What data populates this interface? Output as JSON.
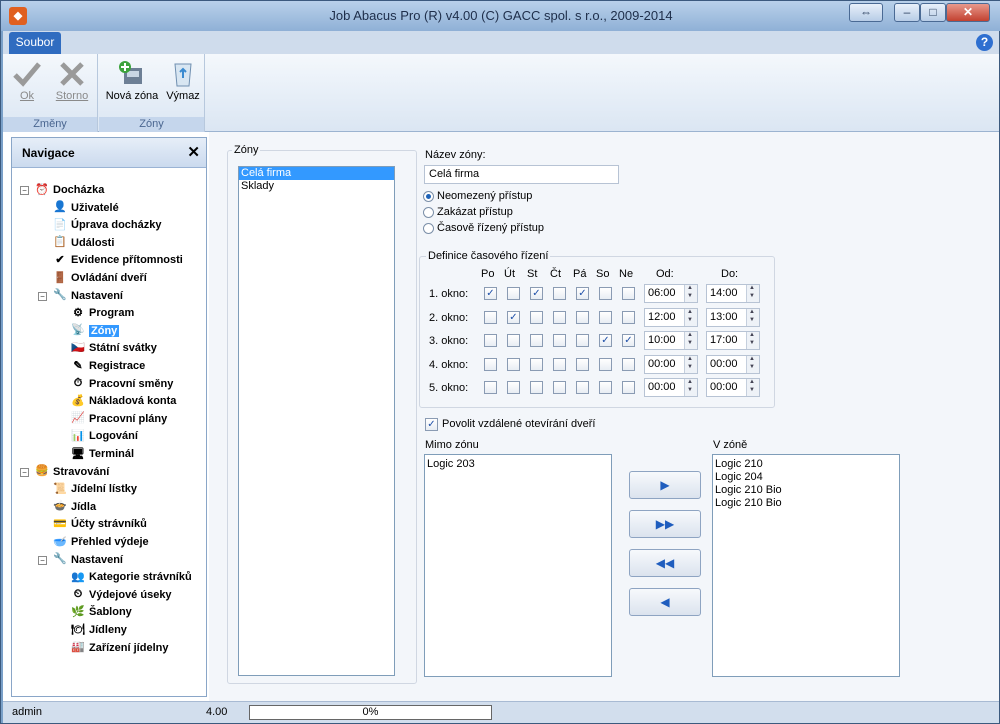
{
  "window": {
    "title": "Job Abacus Pro (R) v4.00 (C) GACC spol. s r.o., 2009-2014"
  },
  "ribbon": {
    "tab": "Soubor",
    "groups": [
      {
        "label": "Změny",
        "buttons": [
          "Ok",
          "Storno"
        ]
      },
      {
        "label": "Zóny",
        "buttons": [
          "Nová zóna",
          "Výmaz"
        ]
      }
    ]
  },
  "navigation": {
    "title": "Navigace",
    "items": [
      {
        "label": "Docházka"
      },
      {
        "label": "Uživatelé"
      },
      {
        "label": "Úprava docházky"
      },
      {
        "label": "Události"
      },
      {
        "label": "Evidence přítomnosti"
      },
      {
        "label": "Ovládání dveří"
      },
      {
        "label": "Nastavení"
      },
      {
        "label": "Program"
      },
      {
        "label": "Zóny"
      },
      {
        "label": "Státní svátky"
      },
      {
        "label": "Registrace"
      },
      {
        "label": "Pracovní směny"
      },
      {
        "label": "Nákladová konta"
      },
      {
        "label": "Pracovní plány"
      },
      {
        "label": "Logování"
      },
      {
        "label": "Terminál"
      },
      {
        "label": "Stravování"
      },
      {
        "label": "Jídelní lístky"
      },
      {
        "label": "Jídla"
      },
      {
        "label": "Účty strávníků"
      },
      {
        "label": "Přehled výdeje"
      },
      {
        "label": "Nastavení"
      },
      {
        "label": "Kategorie strávníků"
      },
      {
        "label": "Výdejové úseky"
      },
      {
        "label": "Šablony"
      },
      {
        "label": "Jídleny"
      },
      {
        "label": "Zařízení jídelny"
      }
    ]
  },
  "zones": {
    "legend": "Zóny",
    "items": [
      "Celá firma",
      "Sklady"
    ]
  },
  "zone_name": {
    "label": "Název zóny:",
    "value": "Celá firma"
  },
  "access": {
    "options": [
      "Neomezený přístup",
      "Zakázat přístup",
      "Časově řízený přístup"
    ],
    "selected": 0
  },
  "time_control": {
    "legend": "Definice časového řízení",
    "days": [
      "Po",
      "Út",
      "St",
      "Čt",
      "Pá",
      "So",
      "Ne"
    ],
    "from_label": "Od:",
    "to_label": "Do:",
    "windows": [
      {
        "label": "1. okno:",
        "checks": [
          true,
          false,
          true,
          false,
          true,
          false,
          false
        ],
        "from": "06:00",
        "to": "14:00"
      },
      {
        "label": "2. okno:",
        "checks": [
          false,
          true,
          false,
          false,
          false,
          false,
          false
        ],
        "from": "12:00",
        "to": "13:00"
      },
      {
        "label": "3. okno:",
        "checks": [
          false,
          false,
          false,
          false,
          false,
          true,
          true
        ],
        "from": "10:00",
        "to": "17:00"
      },
      {
        "label": "4. okno:",
        "checks": [
          false,
          false,
          false,
          false,
          false,
          false,
          false
        ],
        "from": "00:00",
        "to": "00:00"
      },
      {
        "label": "5. okno:",
        "checks": [
          false,
          false,
          false,
          false,
          false,
          false,
          false
        ],
        "from": "00:00",
        "to": "00:00"
      }
    ]
  },
  "remote_open": {
    "label": "Povolit vzdálené otevírání dveří",
    "checked": true
  },
  "outside": {
    "label": "Mimo zónu",
    "items": [
      "Logic 203"
    ]
  },
  "inside": {
    "label": "V zóně",
    "items": [
      "Logic 210",
      "Logic 204",
      "Logic 210 Bio",
      "Logic 210 Bio"
    ]
  },
  "status": {
    "user": "admin",
    "version": "4.00",
    "progress": "0%"
  }
}
